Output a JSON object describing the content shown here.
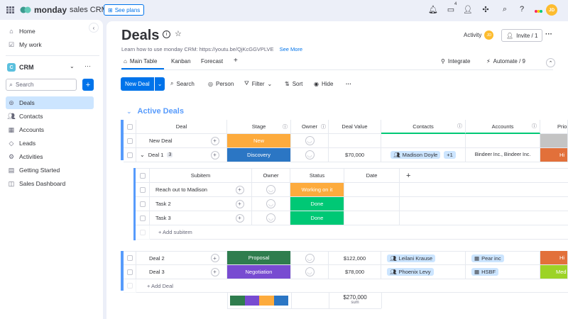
{
  "app": {
    "logo_brand": "monday",
    "logo_product": "sales CRM",
    "see_plans": "See plans",
    "inbox_badge": "4",
    "user_initials": "JD"
  },
  "sidebar": {
    "home": "Home",
    "my_work": "My work",
    "workspace": "CRM",
    "search_placeholder": "Search",
    "items": [
      {
        "label": "Deals"
      },
      {
        "label": "Contacts"
      },
      {
        "label": "Accounts"
      },
      {
        "label": "Leads"
      },
      {
        "label": "Activities"
      },
      {
        "label": "Getting Started"
      },
      {
        "label": "Sales Dashboard"
      }
    ]
  },
  "board": {
    "title": "Deals",
    "description": "Learn how to use monday CRM: https://youtu.be/QjKcGGVPLVE",
    "see_more": "See More",
    "activity": "Activity",
    "invite": "Invite / 1",
    "tabs": [
      "Main Table",
      "Kanban",
      "Forecast"
    ],
    "integrate": "Integrate",
    "automate": "Automate / 9",
    "toolbar": {
      "new_deal": "New Deal",
      "search": "Search",
      "person": "Person",
      "filter": "Filter",
      "sort": "Sort",
      "hide": "Hide"
    }
  },
  "group": {
    "title": "Active Deals",
    "columns": {
      "deal": "Deal",
      "stage": "Stage",
      "owner": "Owner",
      "deal_value": "Deal Value",
      "contacts": "Contacts",
      "accounts": "Accounts",
      "priority": "Prior"
    },
    "rows": [
      {
        "name": "New Deal",
        "stage": "New",
        "stage_color": "#fdab3d",
        "value": "",
        "contacts": "",
        "accounts": "",
        "priority": "",
        "priority_color": "#c4c4c4"
      },
      {
        "name": "Deal 1",
        "subitems_count": "3",
        "stage": "Discovery",
        "stage_color": "#2b76c4",
        "value": "$70,000",
        "contacts": "Madison Doyle",
        "contacts_extra": "+1",
        "accounts": "Bindeer Inc., Bindeer Inc.",
        "priority": "Hi",
        "priority_color": "#e2703a"
      },
      {
        "name": "Deal 2",
        "stage": "Proposal",
        "stage_color": "#2f7d4e",
        "value": "$122,000",
        "contacts": "Leilani Krause",
        "accounts": "Pear inc",
        "priority": "Hi",
        "priority_color": "#e2703a"
      },
      {
        "name": "Deal 3",
        "stage": "Negotiation",
        "stage_color": "#784bd1",
        "value": "$78,000",
        "contacts": "Phoenix Levy",
        "accounts": "HSBF",
        "priority": "Med",
        "priority_color": "#9cd326"
      }
    ],
    "subitems": {
      "columns": {
        "subitem": "Subitem",
        "owner": "Owner",
        "status": "Status",
        "date": "Date"
      },
      "rows": [
        {
          "name": "Reach out to Madison",
          "status": "Working on it",
          "status_color": "#fdab3d"
        },
        {
          "name": "Task 2",
          "status": "Done",
          "status_color": "#00c875"
        },
        {
          "name": "Task 3",
          "status": "Done",
          "status_color": "#00c875"
        }
      ],
      "add_label": "+ Add subitem"
    },
    "add_deal": "+ Add Deal",
    "summary": {
      "value": "$270,000",
      "label": "sum",
      "stage_colors": [
        "#2f7d4e",
        "#784bd1",
        "#fdab3d",
        "#2b76c4"
      ]
    }
  }
}
